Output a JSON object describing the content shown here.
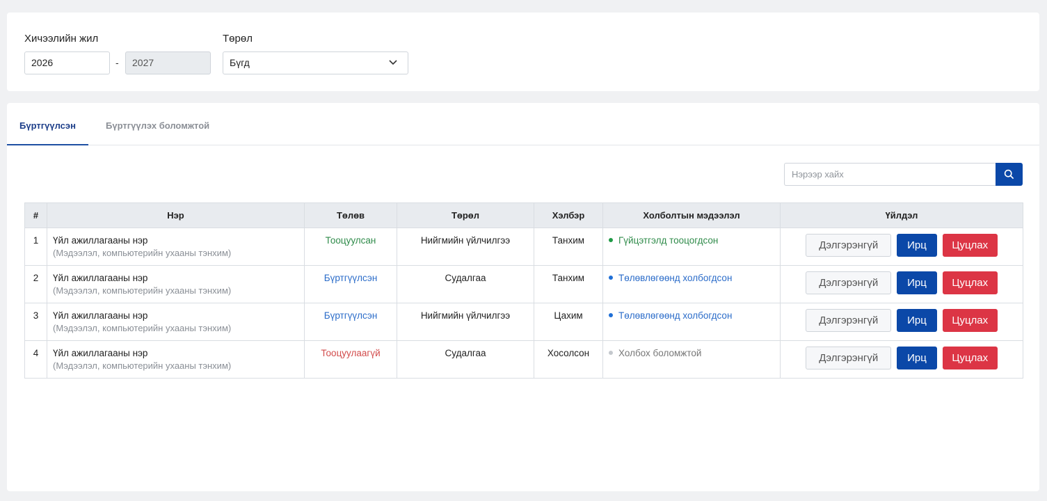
{
  "filters": {
    "year_label": "Хичээлийн жил",
    "year_from": "2026",
    "year_to": "2027",
    "dash": "-",
    "type_label": "Төрөл",
    "type_value": "Бүгд"
  },
  "tabs": [
    {
      "label": "Бүртгүүлсэн",
      "active": true
    },
    {
      "label": "Бүртгүүлэх боломжтой",
      "active": false
    }
  ],
  "search": {
    "placeholder": "Нэрээр хайх"
  },
  "table": {
    "headers": [
      "#",
      "Нэр",
      "Төлөв",
      "Төрөл",
      "Хэлбэр",
      "Холболтын мэдээлэл",
      "Үйлдэл"
    ],
    "rows": [
      {
        "num": "1",
        "name": "Үйл ажиллагааны нэр",
        "sub": "(Мэдээлэл, компьютерийн ухааны тэнхим)",
        "status": "Тооцуулсан",
        "status_color": "green",
        "type": "Нийгмийн үйлчилгээ",
        "form": "Танхим",
        "conn": "Гүйцэтгэлд тооцогдсон",
        "conn_color": "green"
      },
      {
        "num": "2",
        "name": "Үйл ажиллагааны нэр",
        "sub": "(Мэдээлэл, компьютерийн ухааны тэнхим)",
        "status": "Бүртгүүлсэн",
        "status_color": "blue",
        "type": "Судалгаа",
        "form": "Танхим",
        "conn": "Төлөвлөгөөнд холбогдсон",
        "conn_color": "blue"
      },
      {
        "num": "3",
        "name": "Үйл ажиллагааны нэр",
        "sub": "(Мэдээлэл, компьютерийн ухааны тэнхим)",
        "status": "Бүртгүүлсэн",
        "status_color": "blue",
        "type": "Нийгмийн үйлчилгээ",
        "form": "Цахим",
        "conn": "Төлөвлөгөөнд холбогдсон",
        "conn_color": "blue"
      },
      {
        "num": "4",
        "name": "Үйл ажиллагааны нэр",
        "sub": "(Мэдээлэл, компьютерийн ухааны тэнхим)",
        "status": "Тооцуулаагүй",
        "status_color": "red",
        "type": "Судалгаа",
        "form": "Хосолсон",
        "conn": "Холбох боломжтой",
        "conn_color": "gray"
      }
    ],
    "actions": {
      "detail": "Дэлгэрэнгүй",
      "attend": "Ирц",
      "cancel": "Цуцлах"
    }
  },
  "colors": {
    "primary": "#0b48a8",
    "danger": "#dc3545",
    "status_green": "#2f8b4a",
    "status_blue": "#2b6cc9",
    "status_red": "#d24b4b"
  }
}
